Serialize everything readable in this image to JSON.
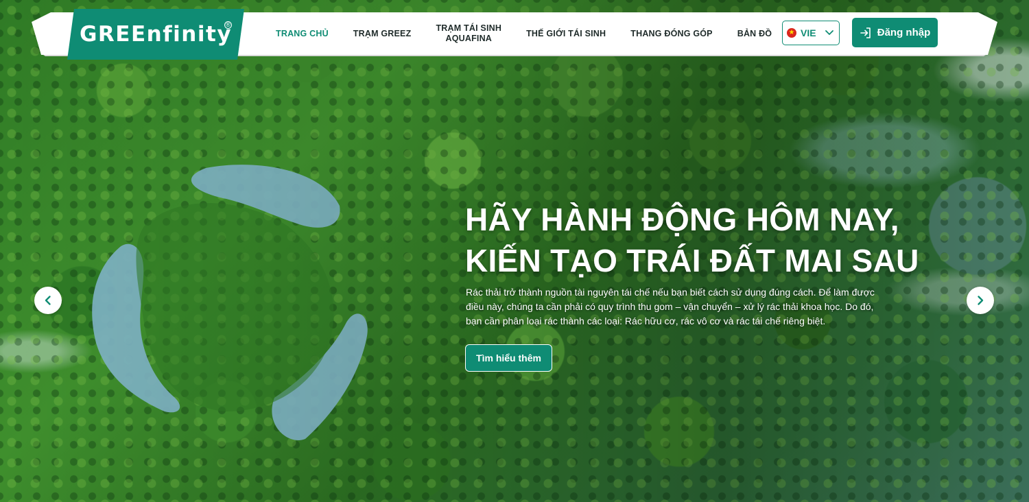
{
  "brand": {
    "logo_text": "GREEnfinity",
    "registered_mark": "®",
    "color": "#0f8c74"
  },
  "nav": {
    "items": [
      {
        "label": "TRANG CHỦ",
        "active": true
      },
      {
        "label": "TRẠM GREEZ",
        "active": false
      },
      {
        "label": "TRẠM TÁI SINH",
        "label_line2": "AQUAFINA",
        "active": false
      },
      {
        "label": "THẾ GIỚI TÁI SINH",
        "active": false
      },
      {
        "label": "THANG ĐÓNG GÓP",
        "active": false
      },
      {
        "label": "BẢN ĐỒ",
        "active": false
      }
    ],
    "language": {
      "label": "VIE",
      "flag": "vietnam-flag-icon",
      "icon": "chevron-down-icon"
    },
    "login": {
      "label": "Đăng nhập",
      "icon": "login-icon"
    }
  },
  "hero": {
    "headline_line1": "HÃY HÀNH ĐỘNG HÔM NAY,",
    "headline_line2": "KIẾN TẠO TRÁI ĐẤT MAI SAU",
    "description": "Rác thải trở thành nguồn tài nguyên tái chế nếu bạn biết cách sử dụng đúng cách. Để làm được điều này, chúng ta cần phải có quy trình thu gom – vận chuyển – xử lý rác thải khoa học. Do đó, bạn cần phân loại rác thành các loại: Rác hữu cơ, rác vô cơ và rác tái chế riêng biệt.",
    "cta_label": "Tìm hiểu thêm",
    "prev_icon": "chevron-left-icon",
    "next_icon": "chevron-right-icon"
  }
}
